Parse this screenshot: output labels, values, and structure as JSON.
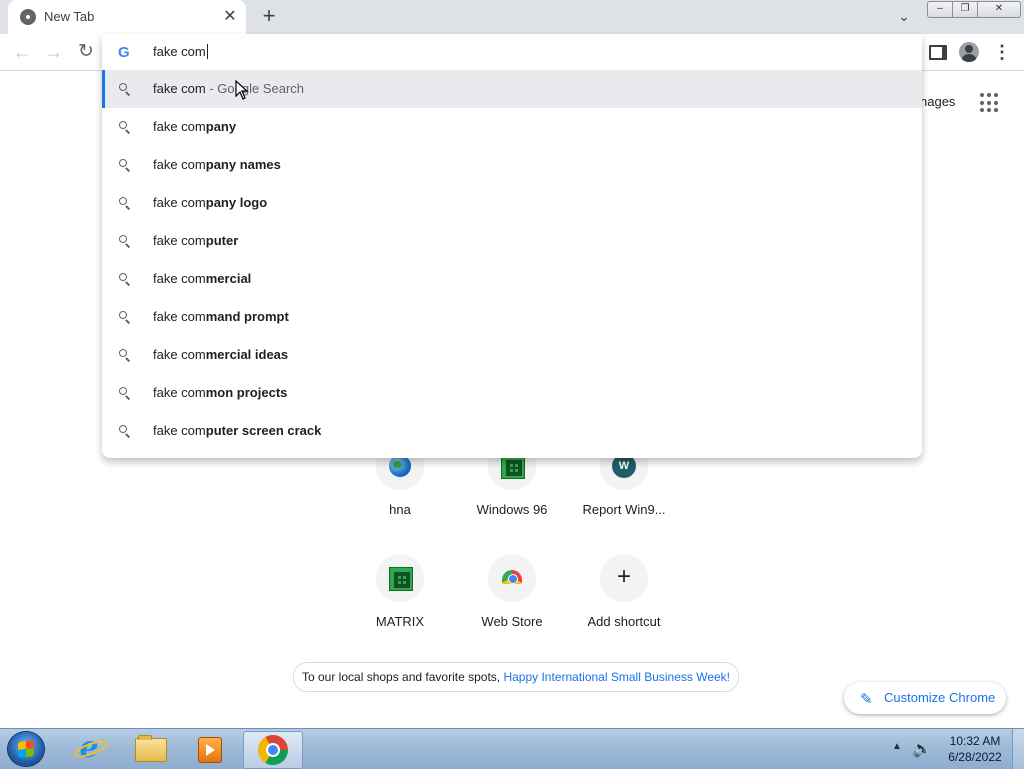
{
  "browser": {
    "tab": {
      "title": "New Tab",
      "close_glyph": "✕"
    },
    "new_tab_glyph": "+",
    "tab_search_glyph": "⌄",
    "window_controls": {
      "minimize": "–",
      "maximize": "❐",
      "close": "✕"
    },
    "nav": {
      "back": "←",
      "forward": "→",
      "reload": "↻"
    },
    "menu_glyph": "⋮"
  },
  "omnibox": {
    "logo": "G",
    "value": "fake com",
    "suggestions": [
      {
        "typed": "fake com",
        "completion": "",
        "desc": " - Google Search",
        "selected": true
      },
      {
        "typed": "fake com",
        "completion": "pany"
      },
      {
        "typed": "fake com",
        "completion": "pany names"
      },
      {
        "typed": "fake com",
        "completion": "pany logo"
      },
      {
        "typed": "fake com",
        "completion": "puter"
      },
      {
        "typed": "fake com",
        "completion": "mercial"
      },
      {
        "typed": "fake com",
        "completion": "mand prompt"
      },
      {
        "typed": "fake com",
        "completion": "mercial ideas"
      },
      {
        "typed": "fake com",
        "completion": "mon projects"
      },
      {
        "typed": "fake com",
        "completion": "puter screen crack"
      }
    ]
  },
  "new_tab_page": {
    "images_link": "nages",
    "shortcuts": [
      {
        "label": "hna",
        "icon": "globe-icon"
      },
      {
        "label": "Windows 96",
        "icon": "windows96-icon"
      },
      {
        "label": "Report Win9...",
        "icon": "w-letter-icon",
        "letter": "W"
      },
      {
        "label": "MATRIX",
        "icon": "windows96-icon"
      },
      {
        "label": "Web Store",
        "icon": "webstore-icon"
      },
      {
        "label": "Add shortcut",
        "icon": "plus-icon",
        "glyph": "+"
      }
    ],
    "doodle_note": {
      "text": "To our local shops and favorite spots, ",
      "link": "Happy International Small Business Week!"
    },
    "customize_button": {
      "icon": "✎",
      "label": "Customize Chrome"
    }
  },
  "taskbar": {
    "apps": [
      "start-orb",
      "internet-explorer-icon",
      "file-explorer-icon",
      "media-player-icon",
      "chrome-icon"
    ],
    "active_app": "chrome-icon",
    "tray_arrow": "▲",
    "speaker_glyph": "🔈",
    "time": "10:32 AM",
    "date": "6/28/2022"
  }
}
